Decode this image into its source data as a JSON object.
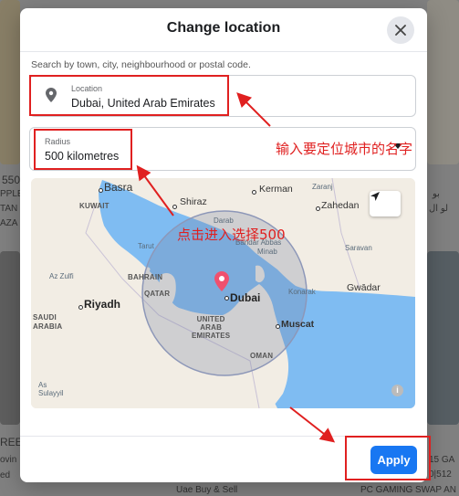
{
  "dialog": {
    "title": "Change location",
    "hint": "Search by town, city, neighbourhood or postal code.",
    "location_label": "Location",
    "location_value": "Dubai, United Arab Emirates",
    "radius_label": "Radius",
    "radius_value": "500 kilometres",
    "apply_label": "Apply"
  },
  "map": {
    "labels": {
      "basra": "Basra",
      "shiraz": "Shiraz",
      "kerman": "Kerman",
      "zaranj": "Zaranj",
      "zahedan": "Zahedan",
      "kuwait": "KUWAIT",
      "darab": "Darab",
      "bandar_abbas": "Bandar Abbas",
      "minab": "Minab",
      "saravan": "Saravan",
      "tarut": "Tarut",
      "bahrain": "BAHRAIN",
      "qatar": "QATAR",
      "dubai": "Dubai",
      "konarak": "Konarak",
      "gwadar": "Gwādar",
      "az_zulfi": "Az Zulfi",
      "riyadh": "Riyadh",
      "saudi_arabia": "SAUDI\nARABIA",
      "uae": "UNITED\nARAB\nEMIRATES",
      "muscat": "Muscat",
      "oman": "OMAN",
      "sulayyil": "As\nSulayyil"
    },
    "colors": {
      "water": "#7fbcf2",
      "land": "#f2ede4",
      "radius_fill": "rgba(120,130,160,0.28)",
      "pin": "#f0506e"
    }
  },
  "annotations": {
    "location_note": "输入要定位城市的名字",
    "radius_note": "点击进入选择500"
  },
  "background": {
    "left_price": "550",
    "left_lines": [
      "PPLE",
      "TAN",
      "AZA"
    ],
    "right_lines": [
      "بو",
      "لو ال"
    ],
    "bottom_left": [
      "REE",
      "ovin",
      "ed"
    ],
    "bottom_center": "Uae Buy & Sell",
    "bottom_right": [
      "15 GA",
      "0|512",
      "PC GAMING SWAP AN"
    ]
  }
}
